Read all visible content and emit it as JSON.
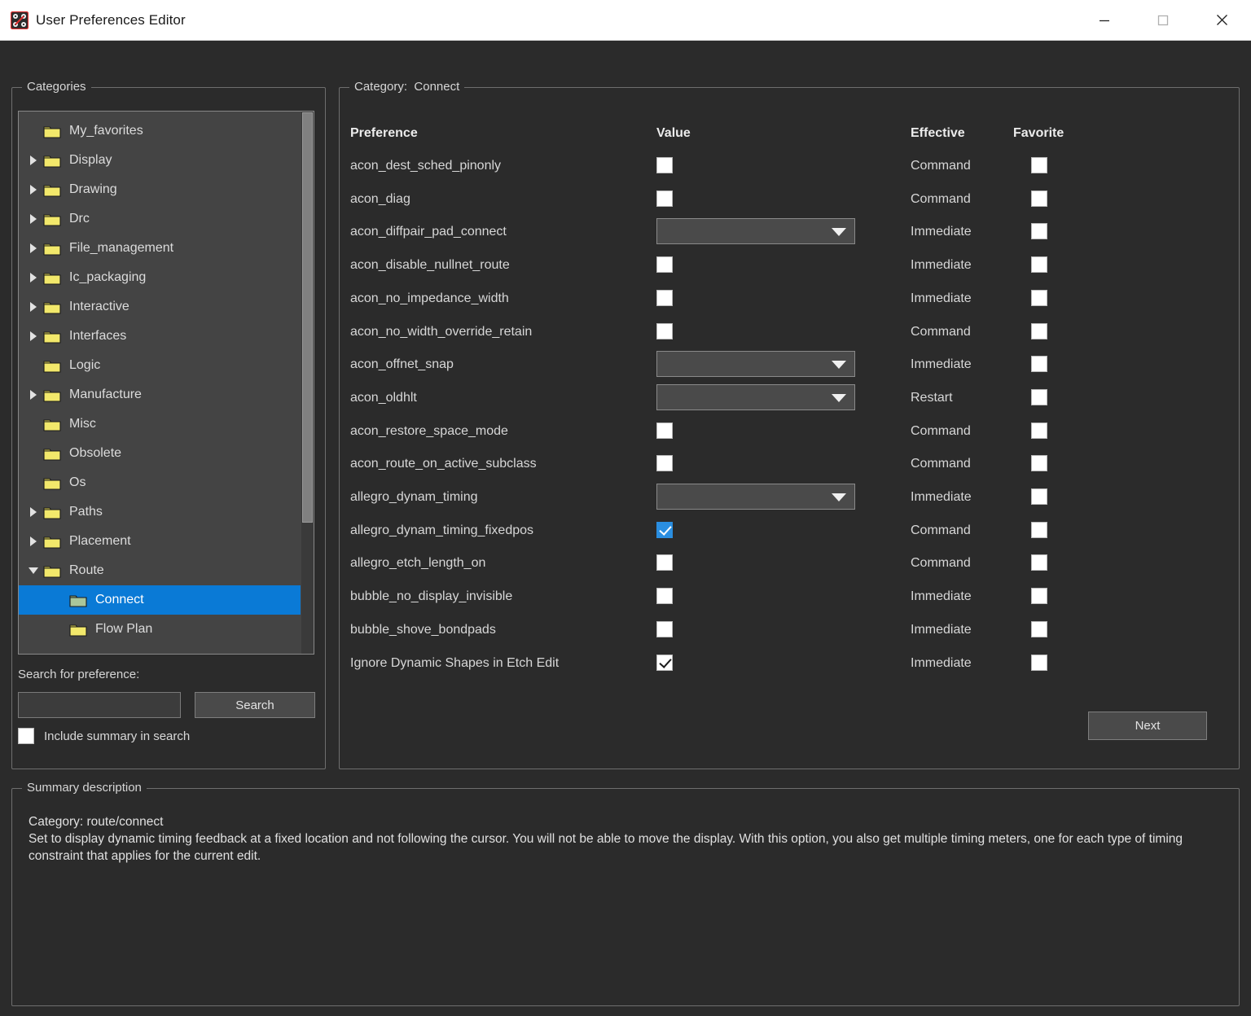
{
  "window": {
    "title": "User Preferences Editor",
    "icon": "pcb-route-icon",
    "controls": {
      "minimize": "minimize-icon",
      "maximize": "maximize-icon",
      "close": "close-icon"
    }
  },
  "colors": {
    "window_bg": "#2b2b2b",
    "panel_bg": "#444444",
    "titlebar_bg": "#ffffff",
    "selection_blue": "#0a7ad6",
    "checkbox_blue": "#2a8ee0",
    "folder_yellow": "#f2e86b",
    "folder_green": "#a9c69a",
    "border": "#6e6e6e",
    "text": "#d7d7d7"
  },
  "categories": {
    "group_label": "Categories",
    "items": [
      {
        "label": "My_favorites",
        "expander": "none",
        "indent": 0,
        "icon": "folder-icon",
        "selected": false
      },
      {
        "label": "Display",
        "expander": "collapsed",
        "indent": 0,
        "icon": "folder-icon",
        "selected": false
      },
      {
        "label": "Drawing",
        "expander": "collapsed",
        "indent": 0,
        "icon": "folder-icon",
        "selected": false
      },
      {
        "label": "Drc",
        "expander": "collapsed",
        "indent": 0,
        "icon": "folder-icon",
        "selected": false
      },
      {
        "label": "File_management",
        "expander": "collapsed",
        "indent": 0,
        "icon": "folder-icon",
        "selected": false
      },
      {
        "label": "Ic_packaging",
        "expander": "collapsed",
        "indent": 0,
        "icon": "folder-icon",
        "selected": false
      },
      {
        "label": "Interactive",
        "expander": "collapsed",
        "indent": 0,
        "icon": "folder-icon",
        "selected": false
      },
      {
        "label": "Interfaces",
        "expander": "collapsed",
        "indent": 0,
        "icon": "folder-icon",
        "selected": false
      },
      {
        "label": "Logic",
        "expander": "none",
        "indent": 0,
        "icon": "folder-icon",
        "selected": false
      },
      {
        "label": "Manufacture",
        "expander": "collapsed",
        "indent": 0,
        "icon": "folder-icon",
        "selected": false
      },
      {
        "label": "Misc",
        "expander": "none",
        "indent": 0,
        "icon": "folder-icon",
        "selected": false
      },
      {
        "label": "Obsolete",
        "expander": "none",
        "indent": 0,
        "icon": "folder-icon",
        "selected": false
      },
      {
        "label": "Os",
        "expander": "none",
        "indent": 0,
        "icon": "folder-icon",
        "selected": false
      },
      {
        "label": "Paths",
        "expander": "collapsed",
        "indent": 0,
        "icon": "folder-icon",
        "selected": false
      },
      {
        "label": "Placement",
        "expander": "collapsed",
        "indent": 0,
        "icon": "folder-icon",
        "selected": false
      },
      {
        "label": "Route",
        "expander": "expanded",
        "indent": 0,
        "icon": "folder-icon",
        "selected": false
      },
      {
        "label": "Connect",
        "expander": "none",
        "indent": 1,
        "icon": "folder-open-icon",
        "selected": true
      },
      {
        "label": "Flow Plan",
        "expander": "none",
        "indent": 1,
        "icon": "folder-icon",
        "selected": false
      }
    ],
    "search": {
      "label": "Search for preference:",
      "value": "",
      "placeholder": "",
      "button_label": "Search",
      "include_summary_label": "Include summary in search",
      "include_summary_checked": false
    }
  },
  "category_panel": {
    "group_label_prefix": "Category:",
    "group_label_value": "Connect",
    "headers": {
      "preference": "Preference",
      "value": "Value",
      "effective": "Effective",
      "favorite": "Favorite"
    },
    "next_button": "Next",
    "rows": [
      {
        "name": "acon_dest_sched_pinonly",
        "value_type": "checkbox",
        "checked": false,
        "highlight": false,
        "effective": "Command",
        "favorite": false
      },
      {
        "name": "acon_diag",
        "value_type": "checkbox",
        "checked": false,
        "highlight": false,
        "effective": "Command",
        "favorite": false
      },
      {
        "name": "acon_diffpair_pad_connect",
        "value_type": "dropdown",
        "selected": "",
        "highlight": false,
        "effective": "Immediate",
        "favorite": false
      },
      {
        "name": "acon_disable_nullnet_route",
        "value_type": "checkbox",
        "checked": false,
        "highlight": false,
        "effective": "Immediate",
        "favorite": false
      },
      {
        "name": "acon_no_impedance_width",
        "value_type": "checkbox",
        "checked": false,
        "highlight": false,
        "effective": "Immediate",
        "favorite": false
      },
      {
        "name": "acon_no_width_override_retain",
        "value_type": "checkbox",
        "checked": false,
        "highlight": false,
        "effective": "Command",
        "favorite": false
      },
      {
        "name": "acon_offnet_snap",
        "value_type": "dropdown",
        "selected": "",
        "highlight": false,
        "effective": "Immediate",
        "favorite": false
      },
      {
        "name": "acon_oldhlt",
        "value_type": "dropdown",
        "selected": "",
        "highlight": false,
        "effective": "Restart",
        "favorite": false
      },
      {
        "name": "acon_restore_space_mode",
        "value_type": "checkbox",
        "checked": false,
        "highlight": false,
        "effective": "Command",
        "favorite": false
      },
      {
        "name": "acon_route_on_active_subclass",
        "value_type": "checkbox",
        "checked": false,
        "highlight": false,
        "effective": "Command",
        "favorite": false
      },
      {
        "name": "allegro_dynam_timing",
        "value_type": "dropdown",
        "selected": "",
        "highlight": false,
        "effective": "Immediate",
        "favorite": false
      },
      {
        "name": "allegro_dynam_timing_fixedpos",
        "value_type": "checkbox",
        "checked": true,
        "highlight": true,
        "effective": "Command",
        "favorite": false
      },
      {
        "name": "allegro_etch_length_on",
        "value_type": "checkbox",
        "checked": false,
        "highlight": false,
        "effective": "Command",
        "favorite": false
      },
      {
        "name": "bubble_no_display_invisible",
        "value_type": "checkbox",
        "checked": false,
        "highlight": false,
        "effective": "Immediate",
        "favorite": false
      },
      {
        "name": "bubble_shove_bondpads",
        "value_type": "checkbox",
        "checked": false,
        "highlight": false,
        "effective": "Immediate",
        "favorite": false
      },
      {
        "name": "Ignore Dynamic Shapes in Etch Edit",
        "value_type": "checkbox",
        "checked": true,
        "highlight": false,
        "effective": "Immediate",
        "favorite": false
      }
    ]
  },
  "summary": {
    "group_label": "Summary description",
    "line1": "Category: route/connect",
    "line2": "Set to display dynamic timing feedback at a fixed location and not following the cursor. You will not be able to move the display. With this option, you also get multiple timing meters, one for each type of timing constraint that applies for the current edit."
  }
}
